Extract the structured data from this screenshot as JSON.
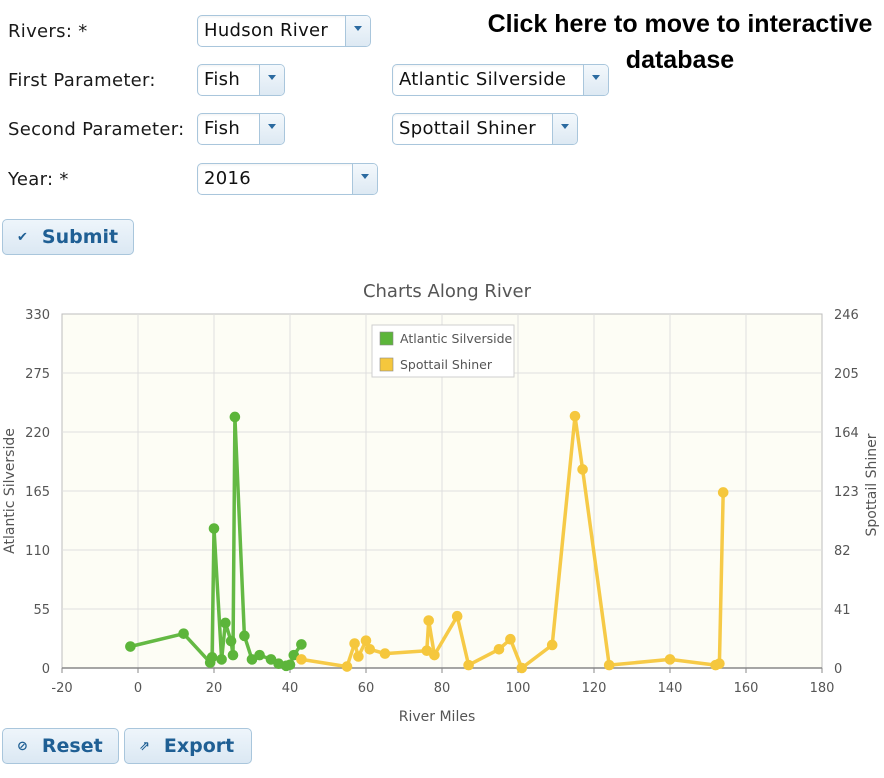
{
  "form": {
    "rivers_label": "Rivers: *",
    "rivers_value": "Hudson River",
    "first_param_label": "First Parameter:",
    "first_param_category": "Fish",
    "first_param_species": "Atlantic Silverside",
    "second_param_label": "Second Parameter:",
    "second_param_category": "Fish",
    "second_param_species": "Spottail Shiner",
    "year_label": "Year: *",
    "year_value": "2016",
    "submit_label": "Submit"
  },
  "link": {
    "database_text": "Click here to move to interactive database"
  },
  "buttons": {
    "reset_label": "Reset",
    "export_label": "Export"
  },
  "chart_data": {
    "type": "line",
    "title": "Charts Along River",
    "xlabel": "River Miles",
    "ylabel_left": "Atlantic Silverside",
    "ylabel_right": "Spottail Shiner",
    "xlim": [
      -20,
      180
    ],
    "xticks": [
      -20,
      0,
      20,
      40,
      60,
      80,
      100,
      120,
      140,
      160,
      180
    ],
    "ylim_left": [
      0,
      330
    ],
    "yticks_left": [
      0,
      55,
      110,
      165,
      220,
      275,
      330
    ],
    "ylim_right": [
      0,
      246
    ],
    "yticks_right": [
      0,
      41,
      82,
      123,
      164,
      205,
      246
    ],
    "grid": true,
    "legend_position": "top-center",
    "series": [
      {
        "name": "Atlantic Silverside",
        "axis": "left",
        "color": "#5cb53a",
        "points": [
          [
            -2,
            20
          ],
          [
            12,
            32
          ],
          [
            19,
            5
          ],
          [
            19.5,
            10
          ],
          [
            20,
            130
          ],
          [
            22,
            8
          ],
          [
            23,
            42
          ],
          [
            24.5,
            25
          ],
          [
            25,
            12
          ],
          [
            25.5,
            234
          ],
          [
            28,
            30
          ],
          [
            30,
            8
          ],
          [
            32,
            12
          ],
          [
            35,
            8
          ],
          [
            37,
            4
          ],
          [
            39,
            2
          ],
          [
            40,
            3
          ],
          [
            41,
            12
          ],
          [
            43,
            22
          ]
        ]
      },
      {
        "name": "Spottail Shiner",
        "axis": "right",
        "color": "#f5c73d",
        "points": [
          [
            43,
            6
          ],
          [
            55,
            1
          ],
          [
            57,
            17
          ],
          [
            58,
            8
          ],
          [
            60,
            19
          ],
          [
            61,
            13
          ],
          [
            65,
            10
          ],
          [
            76,
            12
          ],
          [
            76.5,
            33
          ],
          [
            78,
            9
          ],
          [
            84,
            36
          ],
          [
            87,
            2
          ],
          [
            95,
            13
          ],
          [
            98,
            20
          ],
          [
            101,
            0
          ],
          [
            109,
            16
          ],
          [
            115,
            175
          ],
          [
            117,
            138
          ],
          [
            124,
            2
          ],
          [
            140,
            6
          ],
          [
            152,
            2
          ],
          [
            153,
            3
          ],
          [
            154,
            122
          ]
        ]
      }
    ]
  }
}
